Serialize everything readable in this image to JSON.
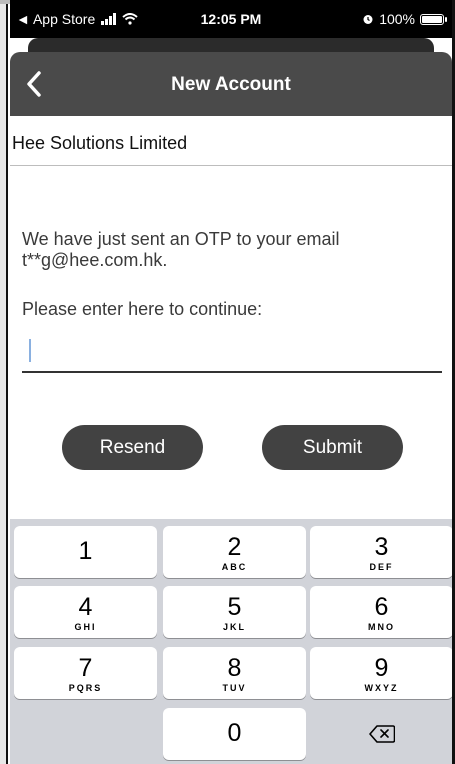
{
  "status_bar": {
    "back_app": "◄ App Store",
    "time": "12:05 PM",
    "battery_percent": "100%",
    "battery_level": 1.0
  },
  "nav": {
    "title": "New Account"
  },
  "company": {
    "name": "Hee Solutions Limited"
  },
  "otp": {
    "message_line1": "We have just sent an OTP to your email",
    "message_line2": "t**g@hee.com.hk.",
    "prompt": "Please enter here to continue:",
    "value": "",
    "placeholder": ""
  },
  "actions": {
    "resend_label": "Resend",
    "submit_label": "Submit"
  },
  "keypad": {
    "keys": [
      {
        "num": "1",
        "letters": ""
      },
      {
        "num": "2",
        "letters": "ABC"
      },
      {
        "num": "3",
        "letters": "DEF"
      },
      {
        "num": "4",
        "letters": "GHI"
      },
      {
        "num": "5",
        "letters": "JKL"
      },
      {
        "num": "6",
        "letters": "MNO"
      },
      {
        "num": "7",
        "letters": "PQRS"
      },
      {
        "num": "8",
        "letters": "TUV"
      },
      {
        "num": "9",
        "letters": "WXYZ"
      },
      {
        "num": "0",
        "letters": ""
      }
    ]
  },
  "colors": {
    "nav_background": "#4a4a4a",
    "button_background": "#424242",
    "keypad_background": "#d1d3d9"
  }
}
